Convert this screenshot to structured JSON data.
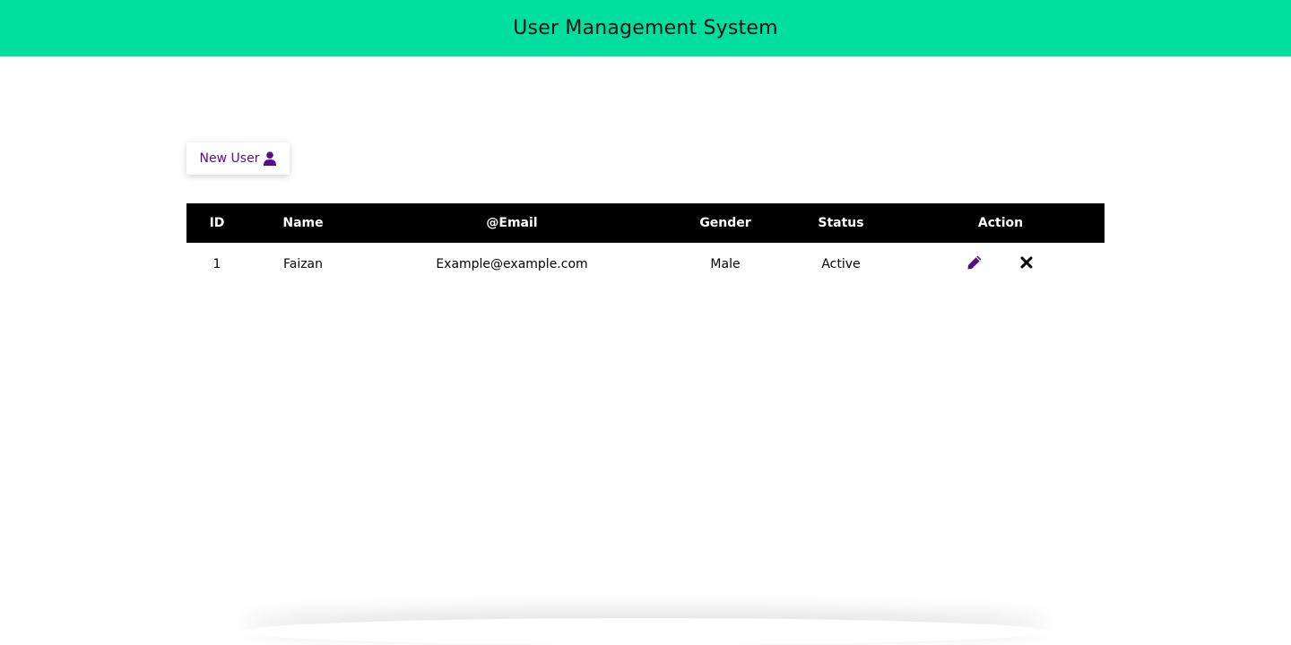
{
  "header": {
    "title": "User Management System",
    "bg_color": "#00df9f"
  },
  "toolbar": {
    "new_user_label": "New User",
    "new_user_icon": "user-icon",
    "accent_color": "#5a0b8a"
  },
  "table": {
    "columns": [
      "ID",
      "Name",
      "@Email",
      "Gender",
      "Status",
      "Action"
    ],
    "rows": [
      {
        "id": "1",
        "name": "Faizan",
        "email": "Example@example.com",
        "gender": "Male",
        "status": "Active",
        "actions": [
          "pencil-icon",
          "close-icon"
        ]
      }
    ]
  }
}
